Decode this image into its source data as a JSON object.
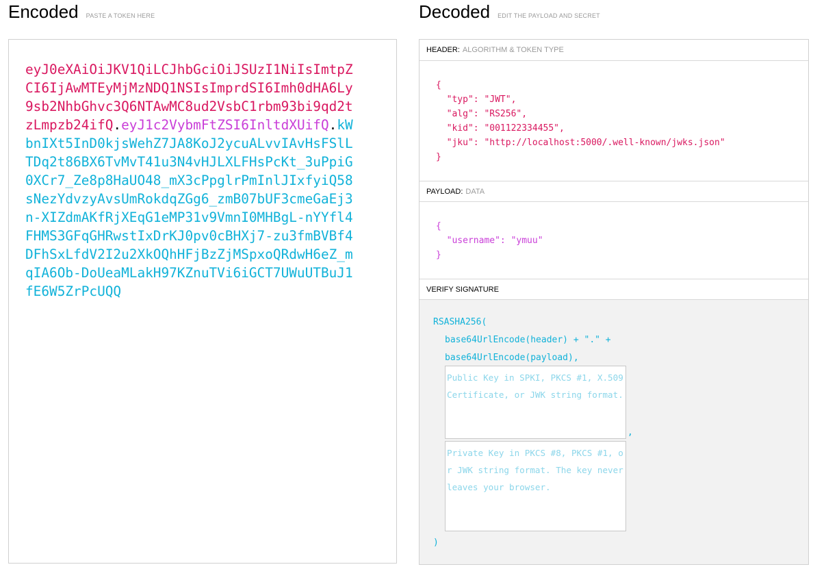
{
  "encoded": {
    "title": "Encoded",
    "subtitle": "PASTE A TOKEN HERE",
    "token": {
      "header": "eyJ0eXAiOiJKV1QiLCJhbGciOiJSUzI1NiIsImtpZCI6IjAwMTEyMjMzNDQ1NSIsImprdSI6Imh0dHA6Ly9sb2NhbGhvc3Q6NTAwMC8ud2VsbC1rbm93bi9qd2tzLmpzb24ifQ",
      "dot1": ".",
      "payload": "eyJ1c2VybmFtZSI6InltdXUifQ",
      "dot2": ".",
      "signature": "kWbnIXt5InD0kjsWehZ7JA8KoJ2ycuALvvIAvHsFSlLTDq2t86BX6TvMvT41u3N4vHJLXLFHsPcKt_3uPpiG0XCr7_Ze8p8HaUO48_mX3cPpglrPmInlJIxfyiQ58sNezYdvzyAvsUmRokdqZGg6_zmB07bUF3cmeGaEj3n-XIZdmAKfRjXEqG1eMP31v9VmnI0MHBgL-nYYfl4FHMS3GFqGHRwstIxDrKJ0pv0cBHXj7-zu3fmBVBf4DFhSxLfdV2I2u2XkOQhHFjBzZjMSpxoQRdwH6eZ_mqIA6Ob-DoUeaMLakH97KZnuTVi6iGCT7UWuUTBuJ1fE6W5ZrPcUQQ"
    }
  },
  "decoded": {
    "title": "Decoded",
    "subtitle": "EDIT THE PAYLOAD AND SECRET",
    "header_section": {
      "label": "HEADER:",
      "sublabel": "ALGORITHM & TOKEN TYPE",
      "json": "{\n  \"typ\": \"JWT\",\n  \"alg\": \"RS256\",\n  \"kid\": \"001122334455\",\n  \"jku\": \"http://localhost:5000/.well-known/jwks.json\"\n}"
    },
    "payload_section": {
      "label": "PAYLOAD:",
      "sublabel": "DATA",
      "json": "{\n  \"username\": \"ymuu\"\n}"
    },
    "verify_section": {
      "label": "VERIFY SIGNATURE",
      "line1": "RSASHA256(",
      "line2": "base64UrlEncode(header) + \".\" +",
      "line3": "base64UrlEncode(payload),",
      "public_key_placeholder": "Public Key in SPKI, PKCS #1, X.509 Certificate, or JWK string format.",
      "comma": ",",
      "private_key_placeholder": "Private Key in PKCS #8, PKCS #1, or JWK string format. The key never leaves your browser.",
      "close": ")"
    }
  },
  "colors": {
    "header": "#d9175f",
    "payload": "#c93ed8",
    "signature": "#11b2d9"
  }
}
